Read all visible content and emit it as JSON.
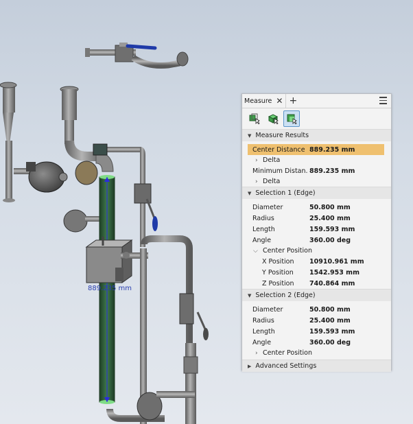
{
  "viewport": {
    "dimension_label": "889.235 mm"
  },
  "panel": {
    "tab_label": "Measure",
    "tab_close": "✕",
    "tab_add": "+",
    "measure_results": {
      "header": "Measure Results",
      "center_distance_label": "Center Distance",
      "center_distance_value": "889.235 mm",
      "delta1_label": "Delta",
      "min_distance_label": "Minimum Distan...",
      "min_distance_value": "889.235 mm",
      "delta2_label": "Delta"
    },
    "selection1": {
      "header": "Selection 1 (Edge)",
      "diameter_label": "Diameter",
      "diameter_value": "50.800 mm",
      "radius_label": "Radius",
      "radius_value": "25.400 mm",
      "length_label": "Length",
      "length_value": "159.593 mm",
      "angle_label": "Angle",
      "angle_value": "360.00 deg",
      "center_position_label": "Center Position",
      "x_label": "X Position",
      "x_value": "10910.961 mm",
      "y_label": "Y Position",
      "y_value": "1542.953 mm",
      "z_label": "Z Position",
      "z_value": "740.864 mm"
    },
    "selection2": {
      "header": "Selection 2 (Edge)",
      "diameter_label": "Diameter",
      "diameter_value": "50.800 mm",
      "radius_label": "Radius",
      "radius_value": "25.400 mm",
      "length_label": "Length",
      "length_value": "159.593 mm",
      "angle_label": "Angle",
      "angle_value": "360.00 deg",
      "center_position_label": "Center Position"
    },
    "advanced_settings_label": "Advanced Settings"
  }
}
